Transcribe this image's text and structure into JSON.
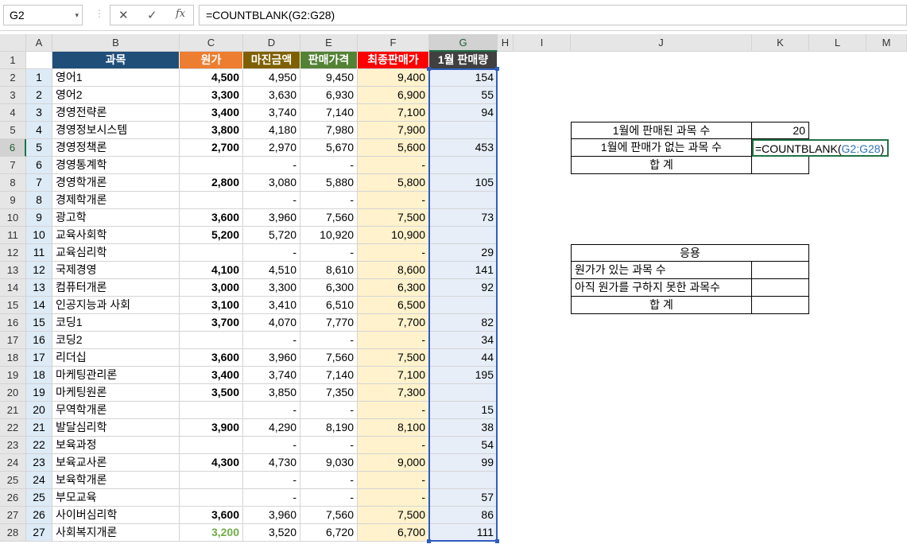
{
  "formula_bar": {
    "name_box": "G2",
    "name_dropdown_icon": "▾",
    "cancel_icon": "✕",
    "enter_icon": "✓",
    "fx_label": "fx",
    "formula": "=COUNTBLANK(G2:G28)"
  },
  "columns": [
    "",
    "A",
    "B",
    "C",
    "D",
    "E",
    "F",
    "G",
    "H",
    "I",
    "J",
    "K",
    "L",
    "M"
  ],
  "header_row": {
    "row": "1",
    "B": "과목",
    "C": "원가",
    "D": "마진금액",
    "E": "판매가격",
    "F": "최종판매가",
    "G": "1월 판매량"
  },
  "rows": [
    {
      "row": "2",
      "A": "1",
      "B": "영어1",
      "C": "4,500",
      "D": "4,950",
      "E": "9,450",
      "F": "9,400",
      "G": "154"
    },
    {
      "row": "3",
      "A": "2",
      "B": "영어2",
      "C": "3,300",
      "D": "3,630",
      "E": "6,930",
      "F": "6,900",
      "G": "55"
    },
    {
      "row": "4",
      "A": "3",
      "B": "경영전략론",
      "C": "3,400",
      "D": "3,740",
      "E": "7,140",
      "F": "7,100",
      "G": "94"
    },
    {
      "row": "5",
      "A": "4",
      "B": "경영정보시스템",
      "C": "3,800",
      "D": "4,180",
      "E": "7,980",
      "F": "7,900",
      "G": ""
    },
    {
      "row": "6",
      "A": "5",
      "B": "경영정책론",
      "C": "2,700",
      "D": "2,970",
      "E": "5,670",
      "F": "5,600",
      "G": "453"
    },
    {
      "row": "7",
      "A": "6",
      "B": "경영통계학",
      "C": "",
      "D": "-",
      "E": "-",
      "F": "-",
      "G": ""
    },
    {
      "row": "8",
      "A": "7",
      "B": "경영학개론",
      "C": "2,800",
      "D": "3,080",
      "E": "5,880",
      "F": "5,800",
      "G": "105"
    },
    {
      "row": "9",
      "A": "8",
      "B": "경제학개론",
      "C": "",
      "D": "-",
      "E": "-",
      "F": "-",
      "G": ""
    },
    {
      "row": "10",
      "A": "9",
      "B": "광고학",
      "C": "3,600",
      "D": "3,960",
      "E": "7,560",
      "F": "7,500",
      "G": "73"
    },
    {
      "row": "11",
      "A": "10",
      "B": "교육사회학",
      "C": "5,200",
      "D": "5,720",
      "E": "10,920",
      "F": "10,900",
      "G": ""
    },
    {
      "row": "12",
      "A": "11",
      "B": "교육심리학",
      "C": "",
      "D": "-",
      "E": "-",
      "F": "-",
      "G": "29"
    },
    {
      "row": "13",
      "A": "12",
      "B": "국제경영",
      "C": "4,100",
      "D": "4,510",
      "E": "8,610",
      "F": "8,600",
      "G": "141"
    },
    {
      "row": "14",
      "A": "13",
      "B": "컴퓨터개론",
      "C": "3,000",
      "D": "3,300",
      "E": "6,300",
      "F": "6,300",
      "G": "92"
    },
    {
      "row": "15",
      "A": "14",
      "B": "인공지능과 사회",
      "C": "3,100",
      "D": "3,410",
      "E": "6,510",
      "F": "6,500",
      "G": ""
    },
    {
      "row": "16",
      "A": "15",
      "B": "코딩1",
      "C": "3,700",
      "D": "4,070",
      "E": "7,770",
      "F": "7,700",
      "G": "82"
    },
    {
      "row": "17",
      "A": "16",
      "B": "코딩2",
      "C": "",
      "D": "-",
      "E": "-",
      "F": "-",
      "G": "34"
    },
    {
      "row": "18",
      "A": "17",
      "B": "리더십",
      "C": "3,600",
      "D": "3,960",
      "E": "7,560",
      "F": "7,500",
      "G": "44"
    },
    {
      "row": "19",
      "A": "18",
      "B": "마케팅관리론",
      "C": "3,400",
      "D": "3,740",
      "E": "7,140",
      "F": "7,100",
      "G": "195"
    },
    {
      "row": "20",
      "A": "19",
      "B": "마케팅원론",
      "C": "3,500",
      "D": "3,850",
      "E": "7,350",
      "F": "7,300",
      "G": ""
    },
    {
      "row": "21",
      "A": "20",
      "B": "무역학개론",
      "C": "",
      "D": "-",
      "E": "-",
      "F": "-",
      "G": "15"
    },
    {
      "row": "22",
      "A": "21",
      "B": "발달심리학",
      "C": "3,900",
      "D": "4,290",
      "E": "8,190",
      "F": "8,100",
      "G": "38"
    },
    {
      "row": "23",
      "A": "22",
      "B": "보육과정",
      "C": "",
      "D": "-",
      "E": "-",
      "F": "-",
      "G": "54"
    },
    {
      "row": "24",
      "A": "23",
      "B": "보육교사론",
      "C": "4,300",
      "D": "4,730",
      "E": "9,030",
      "F": "9,000",
      "G": "99"
    },
    {
      "row": "25",
      "A": "24",
      "B": "보육학개론",
      "C": "",
      "D": "-",
      "E": "-",
      "F": "-",
      "G": ""
    },
    {
      "row": "26",
      "A": "25",
      "B": "부모교육",
      "C": "",
      "D": "-",
      "E": "-",
      "F": "-",
      "G": "57"
    },
    {
      "row": "27",
      "A": "26",
      "B": "사이버심리학",
      "C": "3,600",
      "D": "3,960",
      "E": "7,560",
      "F": "7,500",
      "G": "86"
    },
    {
      "row": "28",
      "A": "27",
      "B": "사회복지개론",
      "C": "3,200",
      "D": "3,520",
      "E": "6,720",
      "F": "6,700",
      "G": "111"
    }
  ],
  "summary": {
    "sold_label": "1월에 판매된 과목 수",
    "sold_value": "20",
    "unsold_label": "1월에 판매가 없는 과목 수",
    "unsold_formula_prefix": "=COUNTBLANK(",
    "unsold_formula_ref": "G2:G28",
    "unsold_formula_suffix": ")",
    "total_label": "합 계"
  },
  "application": {
    "title": "응용",
    "with_cost_label": "원가가 있는 과목 수",
    "without_cost_label": "아직 원가를 구하지 못한 과목수",
    "total_label": "합 계"
  },
  "colors": {
    "header_blue": "#1f4e79",
    "header_orange": "#ed7d31",
    "header_brown": "#7f6000",
    "header_green": "#548235",
    "header_red": "#ff0000",
    "header_dark": "#404040",
    "a_col": "#ddebf7",
    "f_col": "#fff2cc",
    "g_col": "#e7eef8",
    "select": "#217346",
    "ref_blue": "#2e75b6",
    "range_blue": "#2f5dbd"
  }
}
